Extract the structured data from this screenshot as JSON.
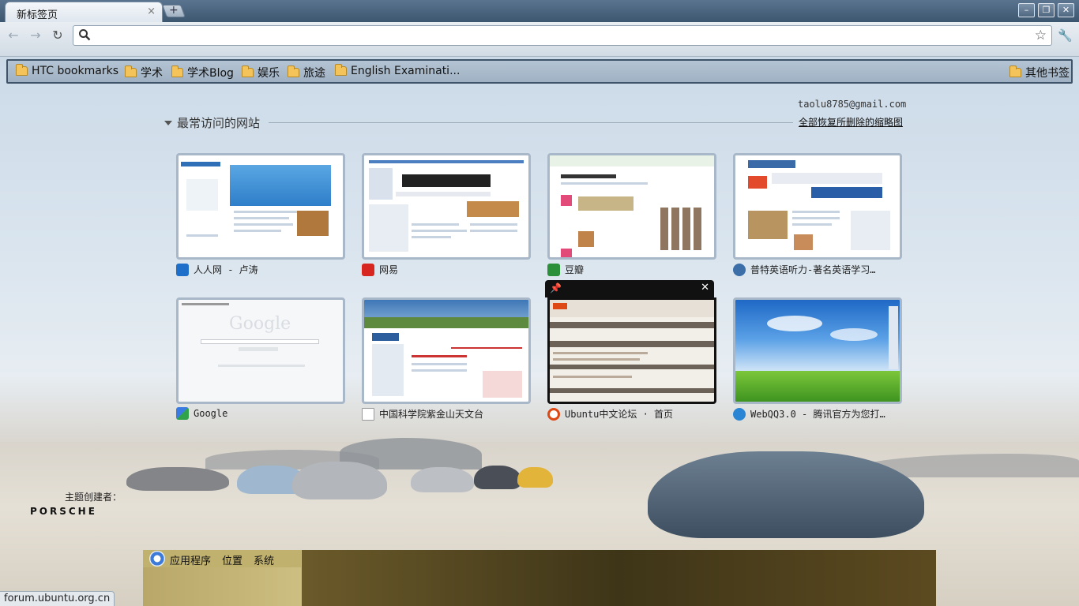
{
  "window": {
    "tab_title": "新标签页",
    "tab_close": "×",
    "new_tab": "+",
    "minimize": "–",
    "maximize": "❐",
    "close": "✕"
  },
  "toolbar": {
    "back": "←",
    "forward": "→",
    "reload": "↻",
    "omnibox_value": "",
    "star": "☆",
    "wrench": "🔧"
  },
  "bookmarks": {
    "items": [
      "HTC bookmarks",
      "学术",
      "学术Blog",
      "娱乐",
      "旅途",
      "English Examinati..."
    ],
    "other": "其他书签"
  },
  "ntp": {
    "account": "taolu8785@gmail.com",
    "section_title": "最常访问的网站",
    "restore_link": "全部恢复所删除的缩略图",
    "tiles": [
      {
        "label": "人人网 - 卢涛",
        "favicon_color": "#1e6fc9"
      },
      {
        "label": "网易",
        "favicon_color": "#d6261f"
      },
      {
        "label": "豆瓣",
        "favicon_color": "#2c8f3a"
      },
      {
        "label": "普特英语听力-著名英语学习…",
        "favicon_color": "#3c6ea8"
      },
      {
        "label": "Google",
        "favicon_color": "#3b7ae0"
      },
      {
        "label": "中国科学院紫金山天文台",
        "favicon_color": "#ffffff"
      },
      {
        "label": "Ubuntu中文论坛 · 首页",
        "favicon_color": "#dd4814"
      },
      {
        "label": "WebQQ3.0 - 腾讯官方为您打…",
        "favicon_color": "#2a86d4"
      }
    ],
    "hover_pin": "📌",
    "hover_close": "✕",
    "thumb_google_text": "Google"
  },
  "theme": {
    "creator_label": "主题创建者：",
    "brand": "PORSCHE"
  },
  "gnome_panel": {
    "menus": [
      "应用程序",
      "位置",
      "系统"
    ]
  },
  "status_bar": {
    "url": "forum.ubuntu.org.cn"
  }
}
